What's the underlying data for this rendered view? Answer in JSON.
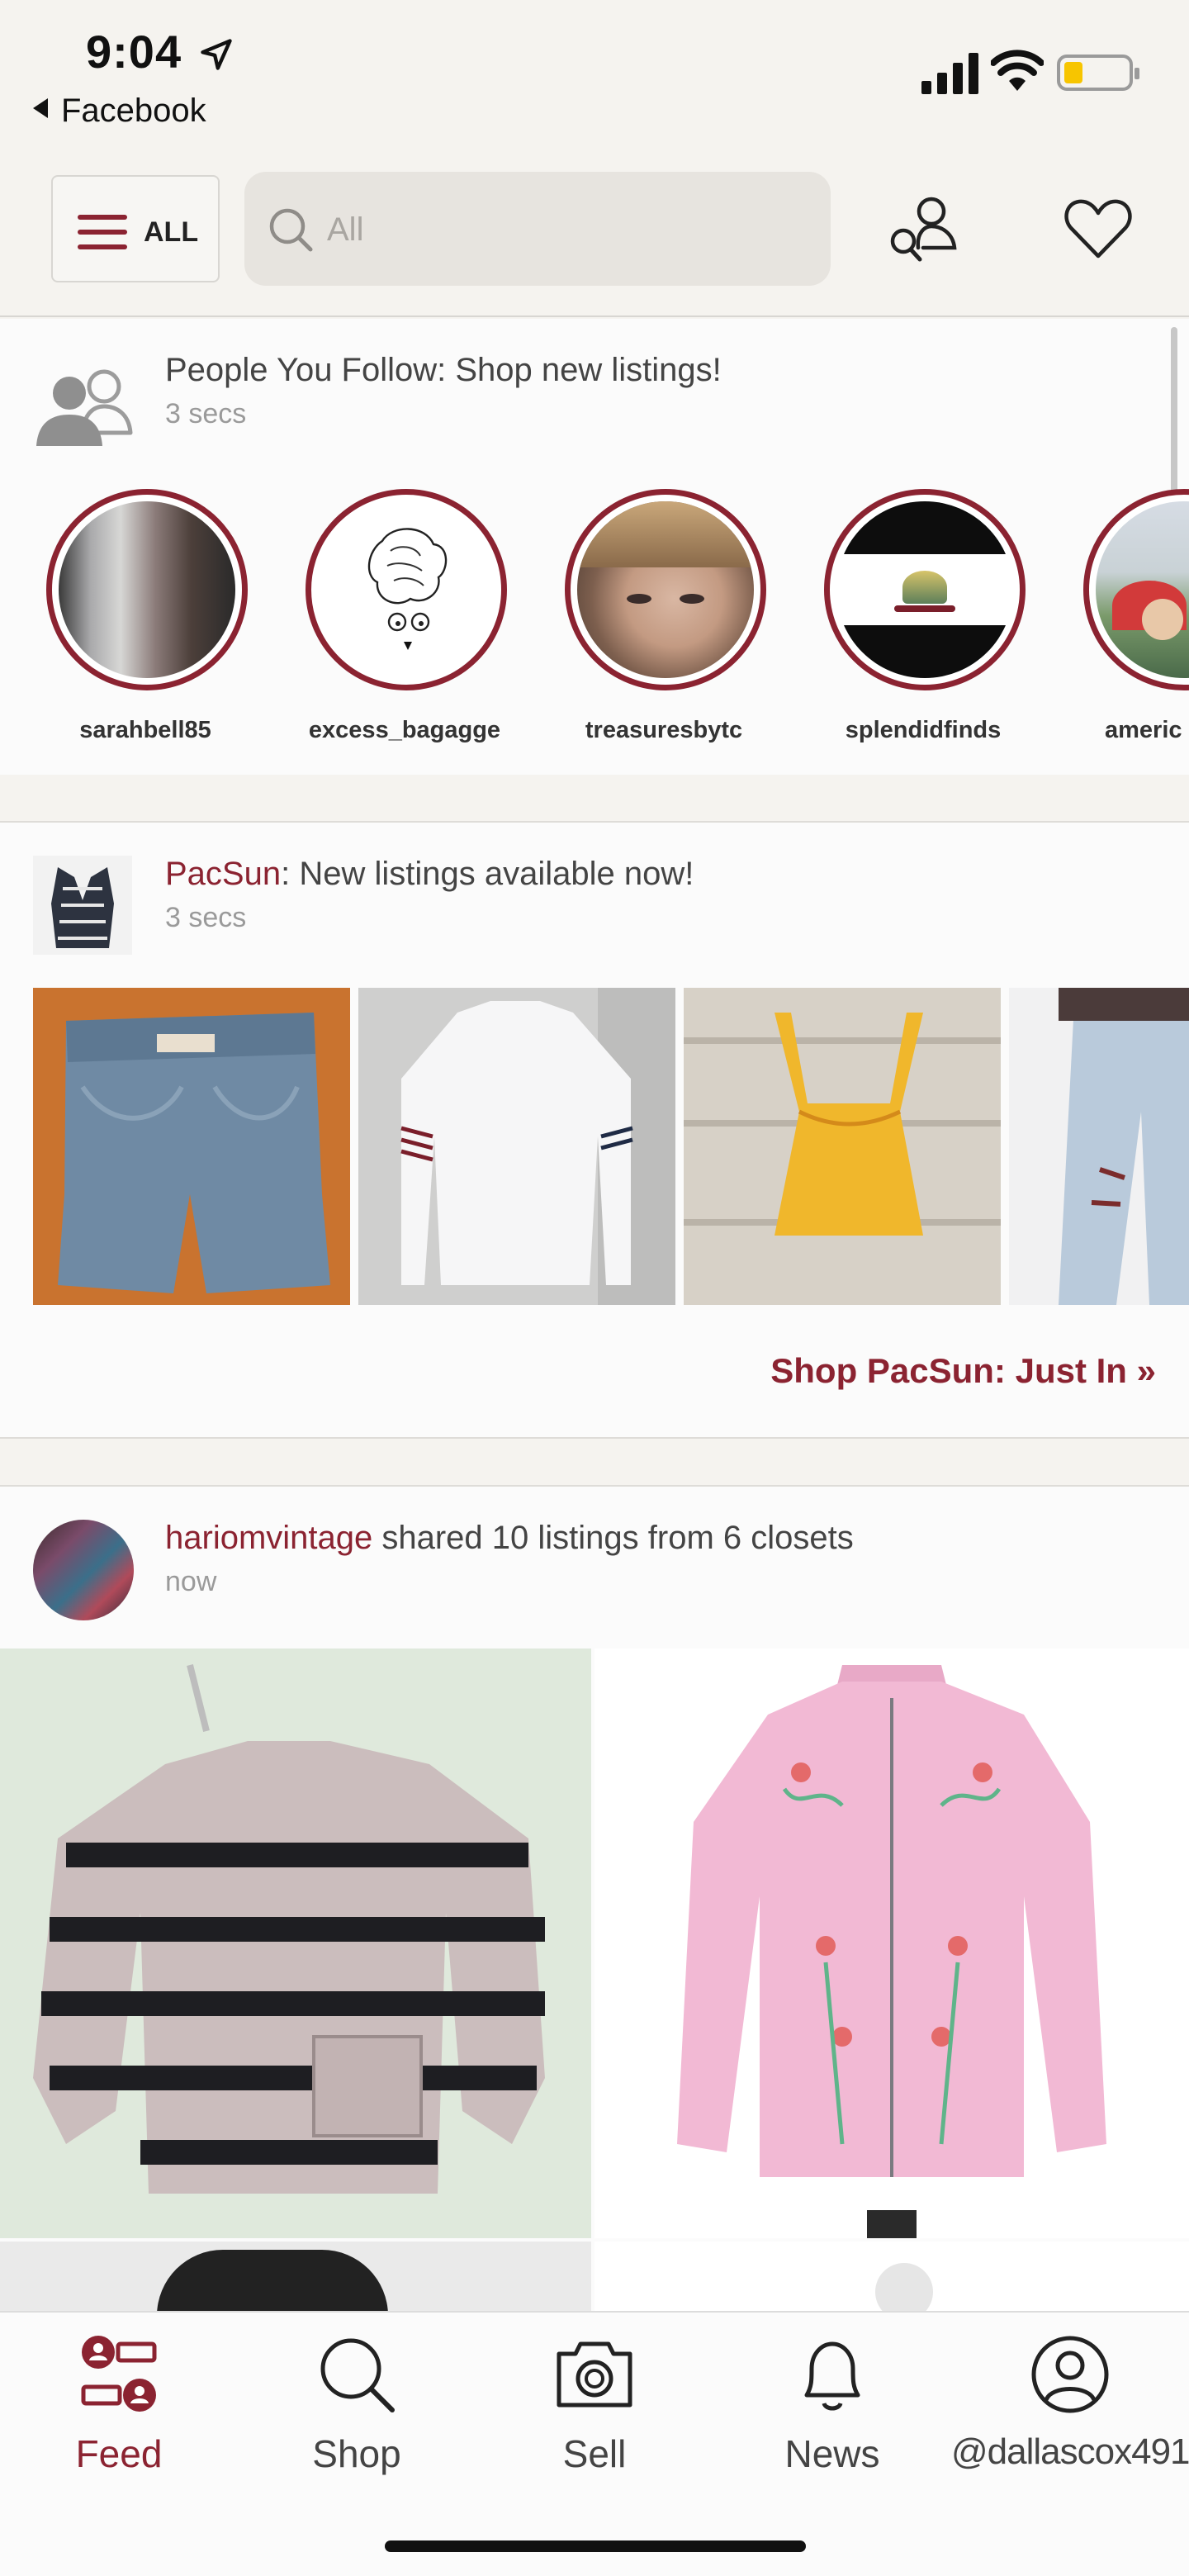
{
  "status": {
    "time": "9:04",
    "back_label": "Facebook"
  },
  "header": {
    "all_label": "ALL",
    "search_placeholder": "All"
  },
  "card_follow": {
    "title": "People You Follow: Shop new listings!",
    "time": "3 secs",
    "closets": [
      {
        "name": "sarahbell85"
      },
      {
        "name": "excess_bagagge"
      },
      {
        "name": "treasuresbytc"
      },
      {
        "name": "splendidfinds"
      },
      {
        "name": "americ"
      }
    ]
  },
  "card_brand": {
    "brand": "PacSun",
    "title_rest": ": New listings available now!",
    "time": "3 secs",
    "link_label": "Shop PacSun: Just In »"
  },
  "card_share": {
    "user": "hariomvintage",
    "title_rest": " shared 10 listings from 6 closets",
    "time": "now"
  },
  "tabbar": {
    "tabs": [
      {
        "label": "Feed",
        "icon": "feed-icon",
        "active": true
      },
      {
        "label": "Shop",
        "icon": "search-icon"
      },
      {
        "label": "Sell",
        "icon": "camera-icon"
      },
      {
        "label": "News",
        "icon": "bell-icon"
      },
      {
        "label": "@dallascox491",
        "icon": "profile-icon"
      }
    ]
  },
  "colors": {
    "accent": "#8b2331",
    "background": "#f5f3ef",
    "card": "#fbfbfb"
  }
}
